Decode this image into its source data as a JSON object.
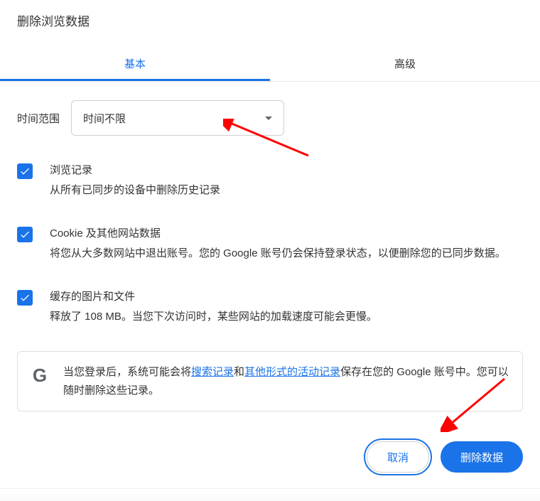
{
  "title": "删除浏览数据",
  "tabs": {
    "basic": "基本",
    "advanced": "高级"
  },
  "time_range": {
    "label": "时间范围",
    "selected": "时间不限"
  },
  "options": [
    {
      "title": "浏览记录",
      "desc": "从所有已同步的设备中删除历史记录"
    },
    {
      "title": "Cookie 及其他网站数据",
      "desc": "将您从大多数网站中退出账号。您的 Google 账号仍会保持登录状态，以便删除您的已同步数据。"
    },
    {
      "title": "缓存的图片和文件",
      "desc": "释放了 108 MB。当您下次访问时，某些网站的加载速度可能会更慢。"
    }
  ],
  "info": {
    "text_before_link1": "当您登录后，系统可能会将",
    "link1": "搜索记录",
    "text_mid": "和",
    "link2": "其他形式的活动记录",
    "text_after": "保存在您的 Google 账号中。您可以随时删除这些记录。"
  },
  "buttons": {
    "cancel": "取消",
    "confirm": "删除数据"
  }
}
